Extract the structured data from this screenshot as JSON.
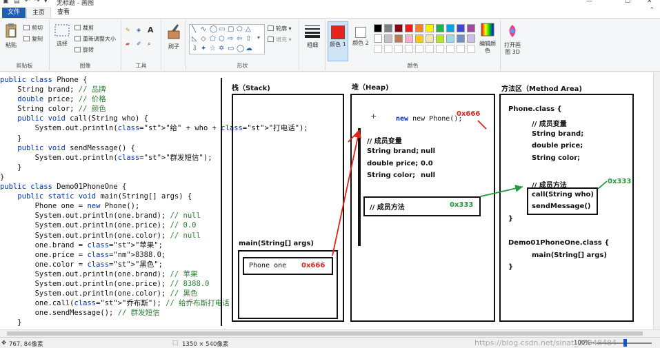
{
  "app": {
    "title": "无标题 - 画图"
  },
  "tabs": [
    {
      "label": "文件"
    },
    {
      "label": "主页"
    },
    {
      "label": "查看"
    }
  ],
  "ribbon": {
    "clipboard": {
      "paste": "粘贴",
      "cut": "剪切",
      "copy": "复制",
      "group": "剪贴板"
    },
    "image": {
      "select": "选择",
      "crop": "裁剪",
      "resize": "重新调整大小",
      "rotate": "旋转",
      "group": "图像"
    },
    "tools": {
      "group": "工具"
    },
    "brush": {
      "label": "刷子"
    },
    "shapes": {
      "outline": "轮廓",
      "fill": "填充",
      "group": "形状"
    },
    "size": {
      "label": "粗细"
    },
    "colors": {
      "color1": "颜色 1",
      "color2": "颜色 2",
      "edit": "编辑颜色",
      "group": "颜色",
      "color1_value": "#e8231c",
      "color2_value": "#ffffff",
      "palette": [
        "#000000",
        "#7f7f7f",
        "#880015",
        "#ed1c24",
        "#ff7f27",
        "#fff200",
        "#22b14c",
        "#00a2e8",
        "#3f48cc",
        "#a349a4",
        "#ffffff",
        "#c3c3c3",
        "#b97a57",
        "#ffaec9",
        "#ffc90e",
        "#efe4b0",
        "#b5e61d",
        "#99d9ea",
        "#7092be",
        "#c8bfe7"
      ]
    },
    "paint3d": {
      "label": "打开画图 3D"
    }
  },
  "code": {
    "lines": [
      "public class Phone {",
      "    String brand; // 品牌",
      "    double price; // 价格",
      "    String color; // 颜色",
      "    public void call(String who) {",
      "        System.out.println(\"给\" + who + \"打电话\");",
      "    }",
      "    public void sendMessage() {",
      "        System.out.println(\"群发短信\");",
      "    }",
      "}",
      "public class Demo01PhoneOne {",
      "    public static void main(String[] args) {",
      "        Phone one = new Phone();",
      "        System.out.println(one.brand); // null",
      "        System.out.println(one.price); // 0.0",
      "        System.out.println(one.color); // null",
      "        one.brand = \"苹果\";",
      "        one.price = 8388.0;",
      "        one.color = \"黑色\";",
      "        System.out.println(one.brand); // 苹果",
      "        System.out.println(one.price); // 8388.0",
      "        System.out.println(one.color); // 黑色",
      "        one.call(\"乔布斯\"); // 给乔布斯打电话",
      "        one.sendMessage(); // 群发短信",
      "    }"
    ]
  },
  "diagram": {
    "stack": {
      "title": "栈（Stack)",
      "frame_label": "main(String[] args)",
      "var": "Phone  one",
      "addr": "0x666"
    },
    "heap": {
      "title": "堆（Heap)",
      "new_label": "new  Phone();",
      "addr": "0x666",
      "member_vars": "// 成员变量",
      "fields": [
        {
          "name": "String brand;",
          "value": "null"
        },
        {
          "name": "double price;",
          "value": "0.0"
        },
        {
          "name": "String color;",
          "value": "null"
        }
      ],
      "member_methods": "// 成员方法",
      "methods_addr": "0x333"
    },
    "method_area": {
      "title": "方法区（Method Area)",
      "phone_class": "Phone.class {",
      "member_vars": "// 成员变量",
      "fields": [
        "String brand;",
        "double price;",
        "String color;"
      ],
      "member_methods": "// 成员方法",
      "methods_addr": "0x333",
      "methods": [
        "call(String who)",
        "sendMessage()"
      ],
      "close": "}",
      "demo_class": "Demo01PhoneOne.class {",
      "main": "main(String[] args)",
      "close2": "}"
    }
  },
  "status": {
    "cursor": "767, 84像素",
    "size": "1350 × 540像素",
    "watermark": "https://blog.csdn.net/sinat_28348484",
    "zoom": "100%"
  }
}
